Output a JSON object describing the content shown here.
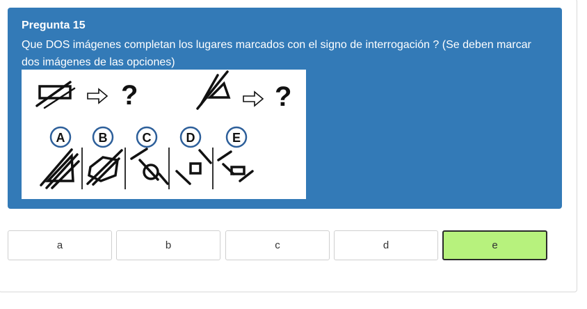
{
  "question": {
    "title": "Pregunta 15",
    "text": "Que DOS imágenes completan los lugares marcados con el signo de interrogación ? (Se deben marcar dos imágenes de las opciones)"
  },
  "figure": {
    "question_marks": [
      "?",
      "?"
    ],
    "option_letters": [
      "A",
      "B",
      "C",
      "D",
      "E"
    ]
  },
  "answers": {
    "options": [
      "a",
      "b",
      "c",
      "d",
      "e"
    ],
    "selected": "e"
  },
  "colors": {
    "card": "#337ab7",
    "selected_bg": "#b7f27d",
    "circle_stroke": "#2d5f9a"
  }
}
